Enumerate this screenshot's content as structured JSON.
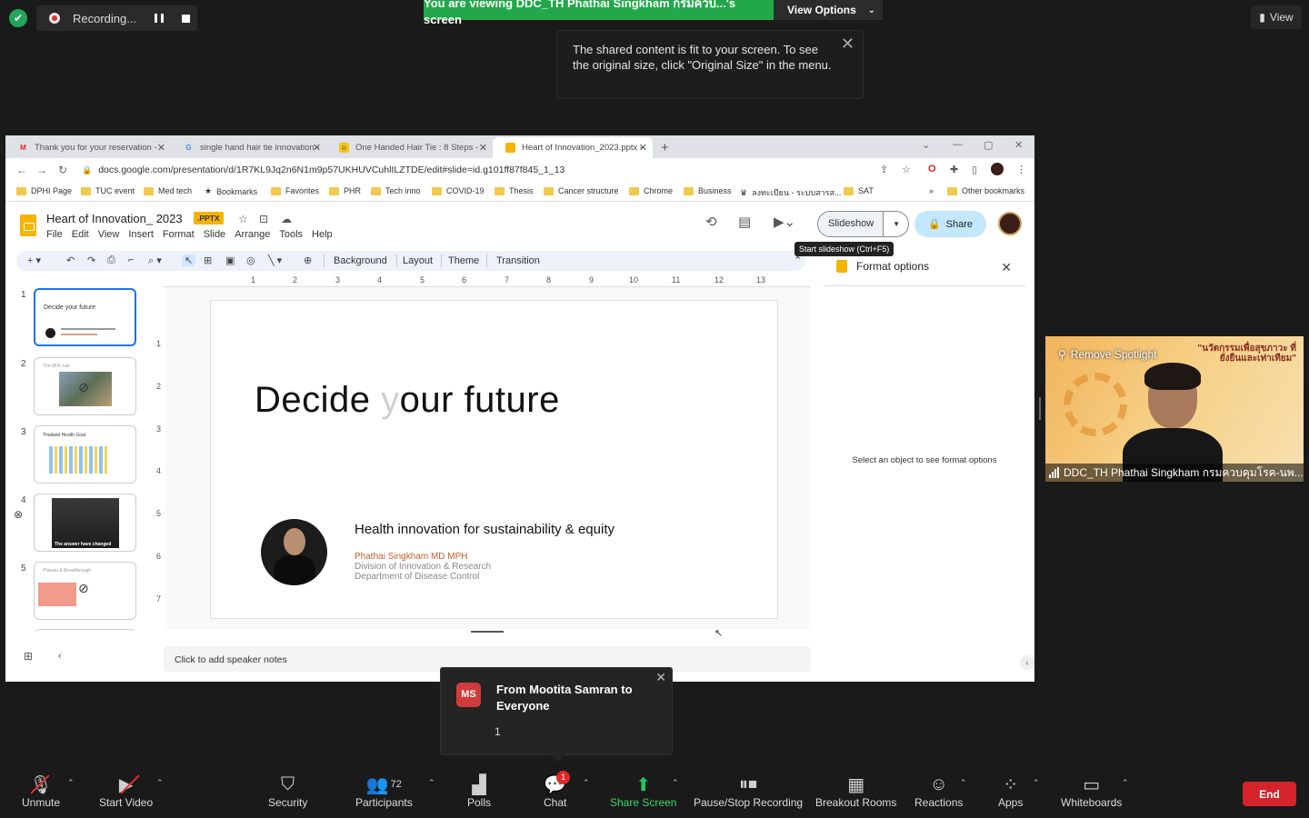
{
  "zoom": {
    "recording_label": "Recording...",
    "viewing_banner": "You are viewing DDC_TH Phathai Singkham กรมควบ...'s screen",
    "view_options": "View Options",
    "view_top": "View",
    "fit_tooltip": "The shared content is fit to your screen. To see the original size, click \"Original Size\" in the menu.",
    "speaker_name": "DDC_TH Phathai Singkham กรมควบคุมโรค-นพ...",
    "remove_spotlight": "Remove Spotlight",
    "video_overlay_text": "\"นวัตกรรมเพื่อสุขภาวะ ที่ยั่งยืนและเท่าเทียม\"",
    "chat_popup": {
      "initials": "MS",
      "from": "From Mootita Samran to Everyone",
      "message": "1"
    },
    "toolbar": {
      "unmute": "Unmute",
      "start_video": "Start Video",
      "security": "Security",
      "participants": "Participants",
      "participants_count": "72",
      "polls": "Polls",
      "chat": "Chat",
      "chat_badge": "1",
      "share_screen": "Share Screen",
      "pause_stop": "Pause/Stop Recording",
      "breakout": "Breakout Rooms",
      "reactions": "Reactions",
      "apps": "Apps",
      "whiteboards": "Whiteboards",
      "end": "End"
    },
    "colors": {
      "green": "#22a84a",
      "end_red": "#d4232a",
      "badge_red": "#e02828"
    }
  },
  "browser": {
    "tabs": [
      {
        "label": "Thank you for your reservation -",
        "icon": "gmail-icon"
      },
      {
        "label": "single hand hair tie innovation -",
        "icon": "google-icon"
      },
      {
        "label": "One Handed Hair Tie : 8 Steps -",
        "icon": "instructables-icon"
      },
      {
        "label": "Heart of Innovation_2023.pptx -",
        "icon": "slides-icon"
      }
    ],
    "url": "docs.google.com/presentation/d/1R7KL9Jq2n6N1m9p57UKHUVCuhlILZTDE/edit#slide=id.g101ff87f845_1_13",
    "bookmarks": [
      "DPHI Page",
      "TUC event",
      "Med tech",
      "Bookmarks",
      "Favorites",
      "PHR",
      "Tech inno",
      "COVID-19",
      "Thesis",
      "Cancer structure",
      "Chrome",
      "Business",
      "ลงทะเบียน - ระบบสารส...",
      "SAT"
    ],
    "other_bookmarks": "Other bookmarks",
    "more": "»"
  },
  "slides": {
    "doc_title": "Heart of Innovation_ 2023",
    "badge": ".PPTX",
    "menu": [
      "File",
      "Edit",
      "View",
      "Insert",
      "Format",
      "Slide",
      "Arrange",
      "Tools",
      "Help"
    ],
    "slideshow": "Slideshow",
    "share": "Share",
    "slideshow_tooltip": "Start slideshow (Ctrl+F5)",
    "toolbar_text": [
      "Background",
      "Layout",
      "Theme",
      "Transition"
    ],
    "format_options": "Format options",
    "format_hint": "Select an object to see format options",
    "ruler": [
      "1",
      "2",
      "3",
      "4",
      "5",
      "6",
      "7",
      "8",
      "9",
      "10",
      "11",
      "12",
      "13"
    ],
    "ruler_left": [
      "1",
      "2",
      "3",
      "4",
      "5",
      "6",
      "7"
    ],
    "speaker_notes": "Click to add speaker notes",
    "thumbnails": [
      {
        "num": "1",
        "title": "Decide your future"
      },
      {
        "num": "2",
        "title": "The 85% rule"
      },
      {
        "num": "3",
        "title": "Thailand Health Goal"
      },
      {
        "num": "4",
        "title": "The answer have changed"
      },
      {
        "num": "5",
        "title": "Plateau & Breakthrough"
      }
    ],
    "slide": {
      "title_pre": "Decide ",
      "title_y": "y",
      "title_post": "our future",
      "subtitle": "Health innovation for sustainability & equity",
      "author": "Phathai Singkham MD MPH",
      "division": "Division of Innovation & Research",
      "department": "Department of Disease Control"
    }
  }
}
